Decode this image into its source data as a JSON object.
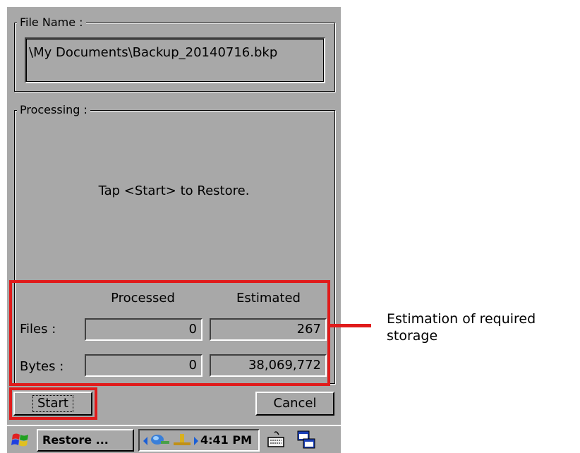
{
  "file_group": {
    "legend": "File Name :",
    "path": "\\My Documents\\Backup_20140716.bkp"
  },
  "processing_group": {
    "legend": "Processing :",
    "message": "Tap <Start> to Restore."
  },
  "stats": {
    "col_processed": "Processed",
    "col_estimated": "Estimated",
    "files_label": "Files :",
    "bytes_label": "Bytes :",
    "files_processed": "0",
    "files_estimated": "267",
    "bytes_processed": "0",
    "bytes_estimated": "38,069,772"
  },
  "buttons": {
    "start": "Start",
    "cancel": "Cancel"
  },
  "taskbar": {
    "task_label": "Restore ...",
    "clock": "4:41 PM"
  },
  "annotation": {
    "line1": "Estimation of required",
    "line2": "storage",
    "color": "#e01b1b"
  },
  "icons": [
    "windows-start-icon",
    "arrow-left-icon",
    "network-icon",
    "connection-icon",
    "arrow-right-icon",
    "keyboard-icon",
    "desktop-switch-icon"
  ]
}
